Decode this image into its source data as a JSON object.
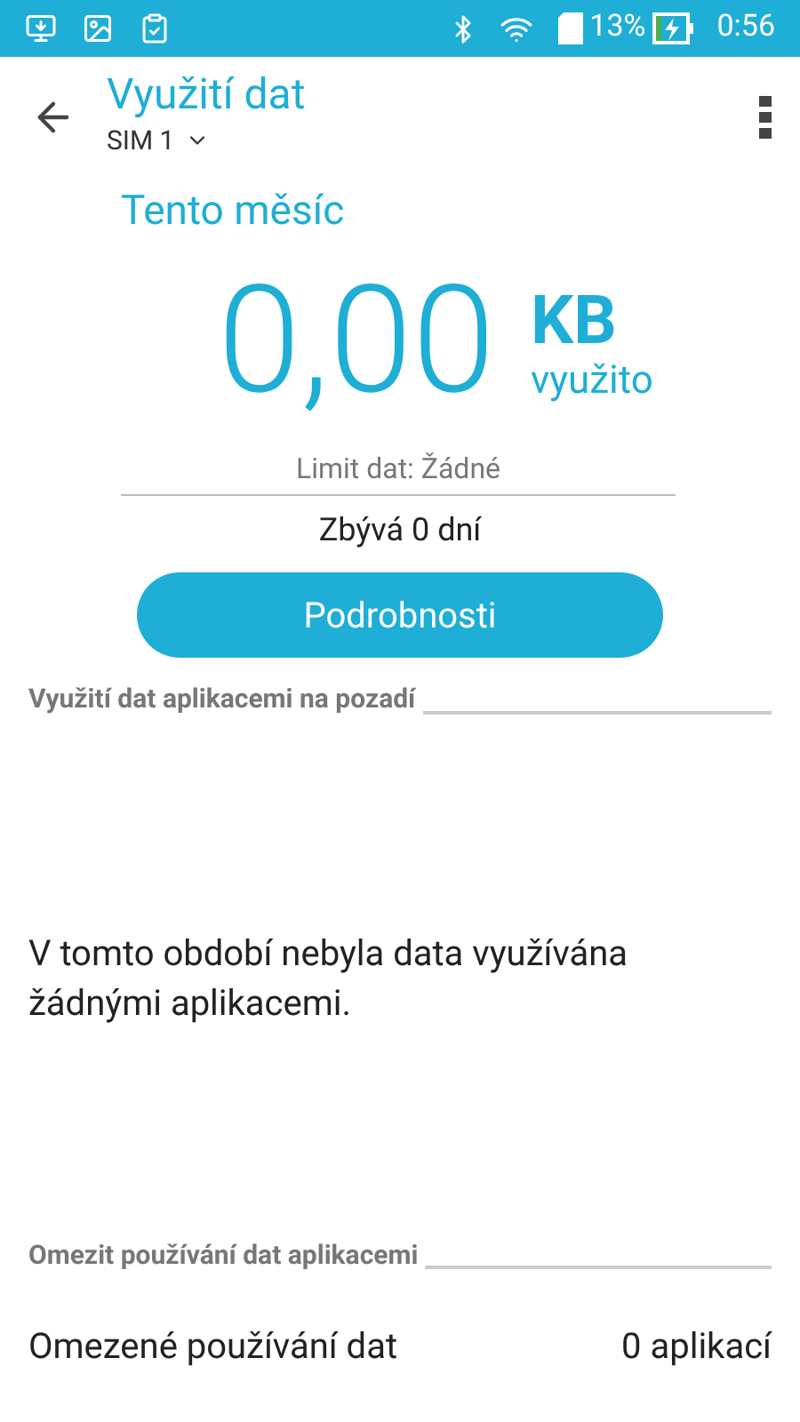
{
  "status_bar": {
    "battery": "13%",
    "time": "0:56"
  },
  "header": {
    "title": "Využití dat",
    "sim": "SIM 1"
  },
  "period": "Tento měsíc",
  "usage": {
    "amount": "0,00",
    "unit": "KB",
    "caption": "využito"
  },
  "limit": "Limit dat: Žádné",
  "remaining": "Zbývá 0 dní",
  "details_button": "Podrobnosti",
  "background_section": {
    "heading": "Využití dat aplikacemi na pozadí",
    "message": "V tomto období nebyla data využívána žádnými aplikacemi."
  },
  "restrict_section": {
    "heading": "Omezit používání dat aplikacemi",
    "rows": [
      {
        "label": "Omezené používání dat",
        "value": "0 aplikací"
      }
    ]
  }
}
